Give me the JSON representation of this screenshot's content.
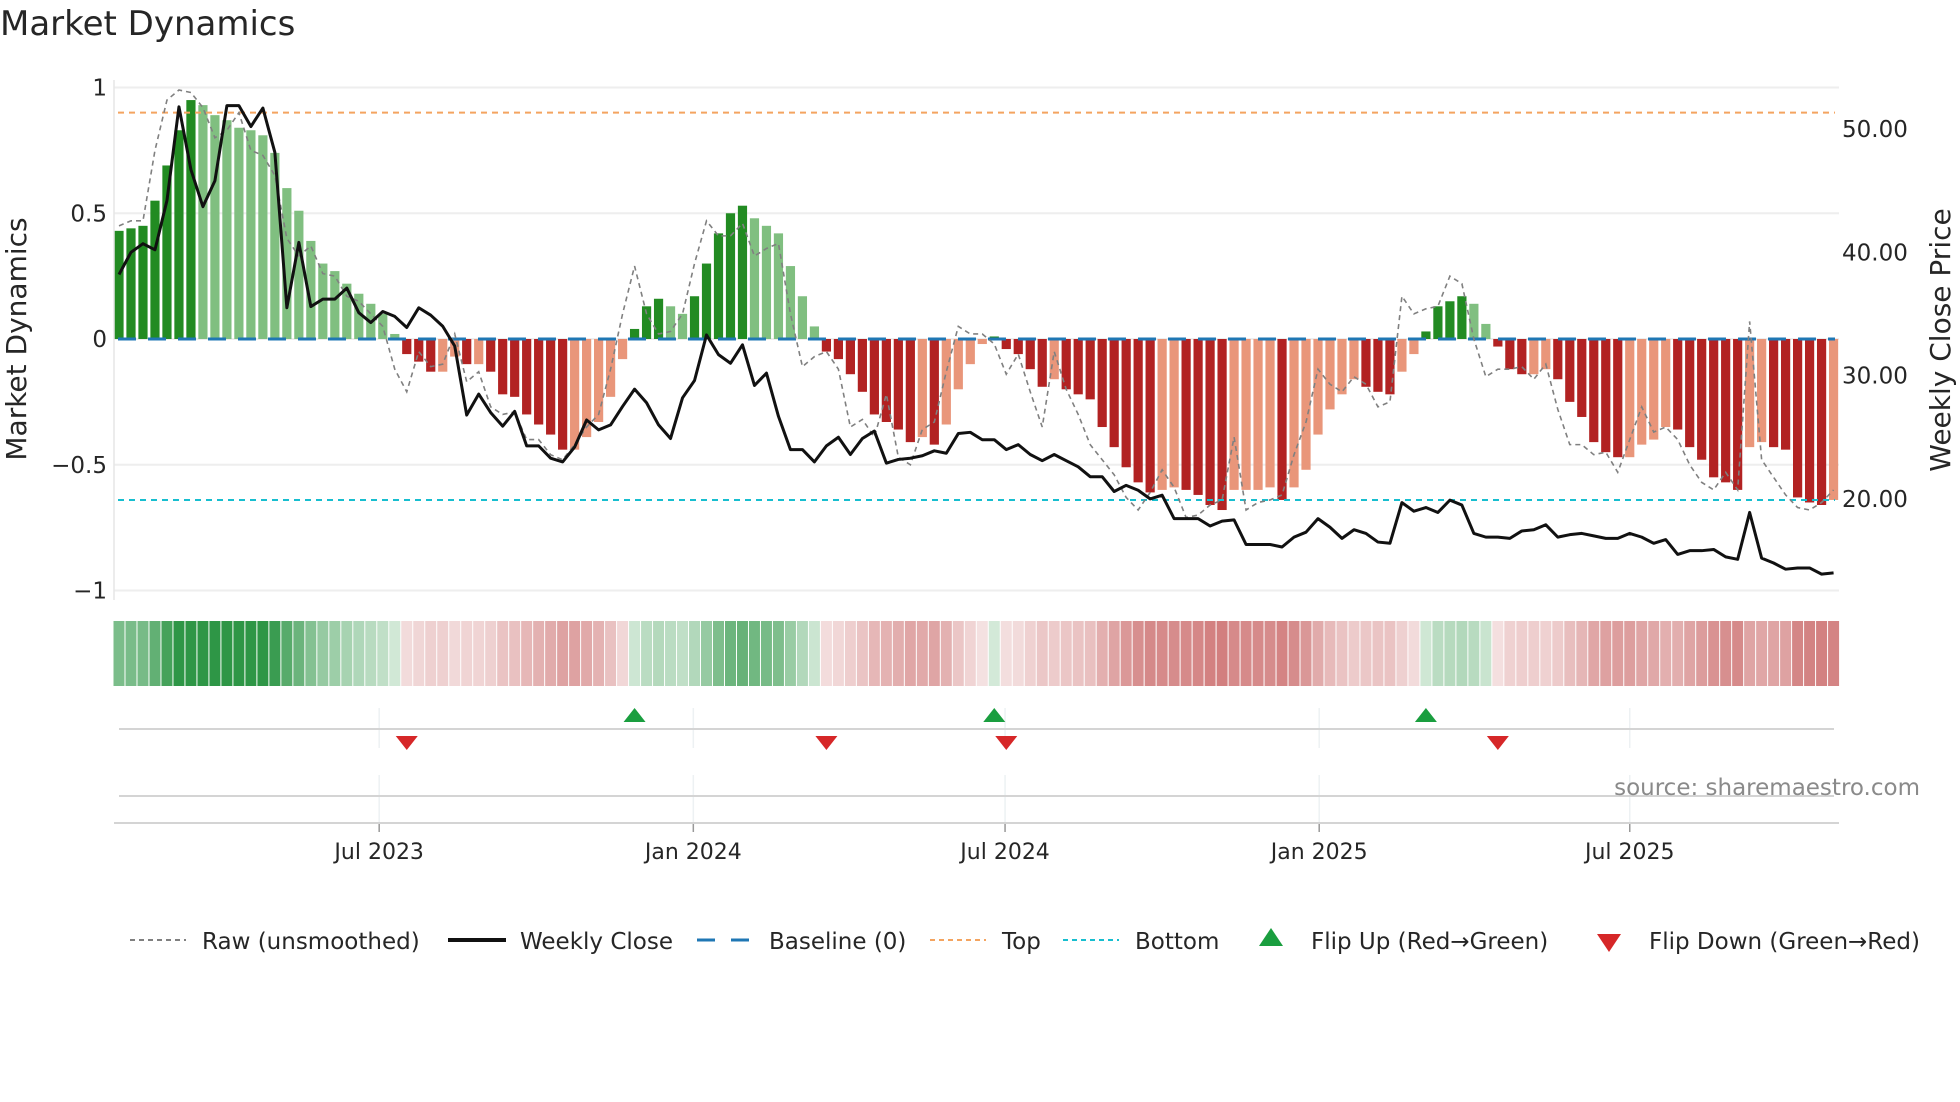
{
  "title": "Market Dynamics",
  "source": "source: sharemaestro.com",
  "colors": {
    "pos_dark": "#228b22",
    "pos_light": "#80bf80",
    "neg_dark": "#b22222",
    "neg_light": "#e9967a",
    "close": "#111111",
    "raw": "#808080",
    "baseline": "#1f77b4",
    "top": "#f4a460",
    "bottom": "#17becf",
    "flip_up": "#1a9e3f",
    "flip_down": "#d62728"
  },
  "chart_data": {
    "type": "bar",
    "title": "Market Dynamics",
    "ylabel": "Market Dynamics",
    "y2label": "Weekly Close Price",
    "ylim": [
      -1,
      1
    ],
    "y2lim": [
      12.6,
      54.4
    ],
    "yticks": [
      {
        "v": 1,
        "label": "1"
      },
      {
        "v": 0.5,
        "label": "0.5"
      },
      {
        "v": 0,
        "label": "0"
      },
      {
        "v": -0.5,
        "label": "−0.5"
      },
      {
        "v": -1,
        "label": "−1"
      }
    ],
    "y2ticks": [
      {
        "v": 50,
        "label": "50.00"
      },
      {
        "v": 40,
        "label": "40.00"
      },
      {
        "v": 30,
        "label": "30.00"
      },
      {
        "v": 20,
        "label": "20.00"
      }
    ],
    "xticks": [
      {
        "week": 21.7,
        "label": "Jul 2023"
      },
      {
        "week": 47.9,
        "label": "Jan 2024"
      },
      {
        "week": 73.9,
        "label": "Jul 2024"
      },
      {
        "week": 100.1,
        "label": "Jan 2025"
      },
      {
        "week": 126,
        "label": "Jul 2025"
      }
    ],
    "top_level": 0.9,
    "bottom_level": -0.64,
    "baseline": 0,
    "smoothed": [
      0.43,
      0.44,
      0.45,
      0.55,
      0.69,
      0.83,
      0.95,
      0.93,
      0.89,
      0.87,
      0.84,
      0.83,
      0.81,
      0.74,
      0.6,
      0.51,
      0.39,
      0.3,
      0.27,
      0.22,
      0.18,
      0.14,
      0.1,
      0.02,
      -0.06,
      -0.09,
      -0.13,
      -0.13,
      -0.07,
      -0.1,
      -0.1,
      -0.13,
      -0.22,
      -0.23,
      -0.3,
      -0.34,
      -0.38,
      -0.44,
      -0.44,
      -0.39,
      -0.33,
      -0.23,
      -0.08,
      0.04,
      0.13,
      0.16,
      0.13,
      0.1,
      0.17,
      0.3,
      0.42,
      0.5,
      0.53,
      0.48,
      0.45,
      0.42,
      0.29,
      0.17,
      0.05,
      -0.05,
      -0.08,
      -0.14,
      -0.21,
      -0.3,
      -0.33,
      -0.36,
      -0.41,
      -0.39,
      -0.42,
      -0.34,
      -0.2,
      -0.1,
      -0.02,
      0.01,
      -0.04,
      -0.06,
      -0.12,
      -0.19,
      -0.16,
      -0.2,
      -0.22,
      -0.24,
      -0.35,
      -0.43,
      -0.51,
      -0.57,
      -0.61,
      -0.6,
      -0.59,
      -0.6,
      -0.62,
      -0.66,
      -0.68,
      -0.6,
      -0.6,
      -0.6,
      -0.59,
      -0.64,
      -0.59,
      -0.52,
      -0.38,
      -0.28,
      -0.22,
      -0.16,
      -0.19,
      -0.21,
      -0.22,
      -0.13,
      -0.06,
      0.03,
      0.13,
      0.15,
      0.17,
      0.14,
      0.06,
      -0.03,
      -0.12,
      -0.14,
      -0.14,
      -0.12,
      -0.16,
      -0.25,
      -0.31,
      -0.41,
      -0.45,
      -0.47,
      -0.47,
      -0.42,
      -0.4,
      -0.35,
      -0.36,
      -0.43,
      -0.48,
      -0.55,
      -0.57,
      -0.6,
      -0.43,
      -0.41,
      -0.43,
      -0.44,
      -0.63,
      -0.65,
      -0.66,
      -0.64
    ],
    "raw": [
      0.45,
      0.47,
      0.47,
      0.75,
      0.95,
      0.99,
      0.98,
      0.92,
      0.8,
      0.83,
      0.9,
      0.75,
      0.73,
      0.65,
      0.4,
      0.33,
      0.37,
      0.26,
      0.25,
      0.17,
      0.15,
      0.1,
      0.05,
      -0.12,
      -0.21,
      -0.05,
      -0.11,
      -0.1,
      0.02,
      -0.17,
      -0.13,
      -0.27,
      -0.3,
      -0.29,
      -0.4,
      -0.4,
      -0.46,
      -0.48,
      -0.42,
      -0.35,
      -0.3,
      -0.12,
      0.1,
      0.29,
      0.1,
      0.02,
      0.03,
      0.1,
      0.3,
      0.47,
      0.41,
      0.41,
      0.46,
      0.33,
      0.36,
      0.38,
      0.1,
      -0.11,
      -0.07,
      -0.05,
      -0.12,
      -0.35,
      -0.32,
      -0.39,
      -0.22,
      -0.47,
      -0.5,
      -0.36,
      -0.33,
      -0.13,
      0.05,
      0.02,
      0.02,
      -0.02,
      -0.14,
      -0.06,
      -0.21,
      -0.35,
      -0.05,
      -0.2,
      -0.3,
      -0.42,
      -0.48,
      -0.54,
      -0.63,
      -0.68,
      -0.61,
      -0.52,
      -0.59,
      -0.71,
      -0.7,
      -0.66,
      -0.64,
      -0.39,
      -0.68,
      -0.65,
      -0.64,
      -0.62,
      -0.46,
      -0.33,
      -0.12,
      -0.18,
      -0.21,
      -0.15,
      -0.18,
      -0.27,
      -0.25,
      0.17,
      0.1,
      0.12,
      0.13,
      0.25,
      0.22,
      0.0,
      -0.15,
      -0.12,
      -0.12,
      -0.11,
      -0.16,
      -0.1,
      -0.28,
      -0.42,
      -0.42,
      -0.46,
      -0.45,
      -0.53,
      -0.4,
      -0.27,
      -0.37,
      -0.35,
      -0.4,
      -0.5,
      -0.57,
      -0.6,
      -0.53,
      -0.6,
      0.07,
      -0.48,
      -0.55,
      -0.62,
      -0.67,
      -0.68,
      -0.65,
      -0.6
    ],
    "weekly_close": [
      38.2,
      40.0,
      40.7,
      40.2,
      44.2,
      51.8,
      46.7,
      43.7,
      45.8,
      51.9,
      51.9,
      50.2,
      51.7,
      48.1,
      35.5,
      40.8,
      35.6,
      36.2,
      36.2,
      37.1,
      35.1,
      34.3,
      35.2,
      34.8,
      33.9,
      35.5,
      34.9,
      34.0,
      32.4,
      26.8,
      28.5,
      27.0,
      25.9,
      27.1,
      24.3,
      24.3,
      23.3,
      23.0,
      24.2,
      26.4,
      25.6,
      26.0,
      27.5,
      28.9,
      27.8,
      26.0,
      24.9,
      28.2,
      29.6,
      33.3,
      31.7,
      31.0,
      32.5,
      29.2,
      30.2,
      26.7,
      24.0,
      24.0,
      23.0,
      24.3,
      25.0,
      23.6,
      24.9,
      25.5,
      22.9,
      23.2,
      23.3,
      23.5,
      23.9,
      23.7,
      25.3,
      25.4,
      24.8,
      24.8,
      24.0,
      24.4,
      23.6,
      23.1,
      23.6,
      23.1,
      22.6,
      21.8,
      21.8,
      20.6,
      21.1,
      20.7,
      20.0,
      20.3,
      18.4,
      18.4,
      18.4,
      17.8,
      18.2,
      18.3,
      16.3,
      16.3,
      16.3,
      16.1,
      16.9,
      17.3,
      18.4,
      17.7,
      16.8,
      17.5,
      17.2,
      16.5,
      16.4,
      19.7,
      19.0,
      19.3,
      18.9,
      19.9,
      19.5,
      17.2,
      16.9,
      16.9,
      16.8,
      17.4,
      17.5,
      17.9,
      16.9,
      17.1,
      17.2,
      17.0,
      16.8,
      16.8,
      17.2,
      16.9,
      16.4,
      16.7,
      15.5,
      15.8,
      15.8,
      15.9,
      15.3,
      15.1,
      18.9,
      15.2,
      14.8,
      14.3,
      14.4,
      14.4,
      13.9,
      14.0
    ],
    "flip_up_weeks": [
      43,
      73,
      109
    ],
    "flip_down_weeks": [
      24,
      59,
      74,
      115
    ],
    "legend": [
      {
        "key": "raw",
        "label": "Raw (unsmoothed)"
      },
      {
        "key": "close",
        "label": "Weekly Close"
      },
      {
        "key": "baseline",
        "label": "Baseline (0)"
      },
      {
        "key": "top",
        "label": "Top"
      },
      {
        "key": "bottom",
        "label": "Bottom"
      },
      {
        "key": "flip_up",
        "label": "Flip Up (Red→Green)"
      },
      {
        "key": "flip_down",
        "label": "Flip Down (Green→Red)"
      }
    ],
    "legend_position": "bottom"
  }
}
